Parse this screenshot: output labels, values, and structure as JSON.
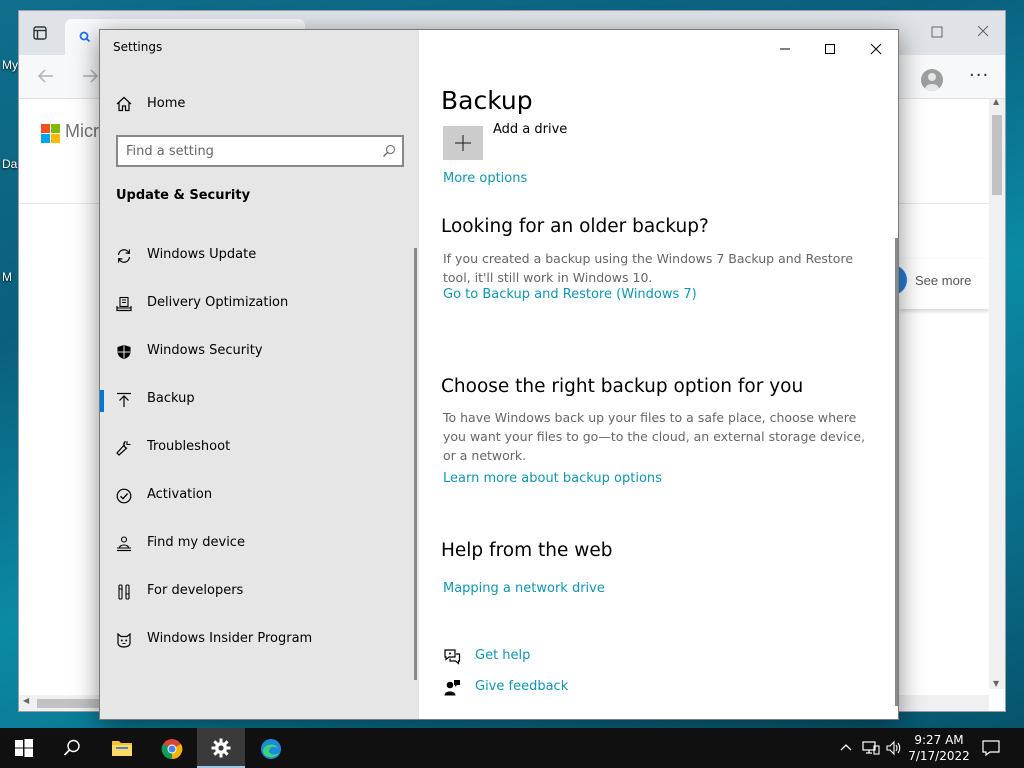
{
  "desktop": {
    "labels": [
      "My",
      "Da",
      "M"
    ]
  },
  "browser": {
    "brand_text": "Micro",
    "see_more": "See more",
    "more_glyph": "···"
  },
  "settings": {
    "window_title": "Settings",
    "nav": {
      "home_label": "Home",
      "search_placeholder": "Find a setting",
      "section_title": "Update & Security",
      "items": [
        {
          "label": "Windows Update",
          "icon": "sync-icon"
        },
        {
          "label": "Delivery Optimization",
          "icon": "delivery-icon"
        },
        {
          "label": "Windows Security",
          "icon": "shield-icon"
        },
        {
          "label": "Backup",
          "icon": "backup-arrow-icon",
          "selected": true
        },
        {
          "label": "Troubleshoot",
          "icon": "wrench-icon"
        },
        {
          "label": "Activation",
          "icon": "check-circle-icon"
        },
        {
          "label": "Find my device",
          "icon": "person-location-icon"
        },
        {
          "label": "For developers",
          "icon": "tools-icon"
        },
        {
          "label": "Windows Insider Program",
          "icon": "insider-cat-icon"
        }
      ]
    },
    "content": {
      "title": "Backup",
      "add_drive_label": "Add a drive",
      "more_options": "More options",
      "older_backup": {
        "heading": "Looking for an older backup?",
        "text": "If you created a backup using the Windows 7 Backup and Restore tool, it'll still work in Windows 10.",
        "link": "Go to Backup and Restore (Windows 7)"
      },
      "right_option": {
        "heading": "Choose the right backup option for you",
        "text": "To have Windows back up your files to a safe place, choose where you want your files to go—to the cloud, an external storage device, or a network.",
        "link": "Learn more about backup options"
      },
      "help_web": {
        "heading": "Help from the web",
        "link": "Mapping a network drive"
      },
      "get_help": "Get help",
      "give_feedback": "Give feedback"
    }
  },
  "taskbar": {
    "time": "9:27 AM",
    "date": "7/17/2022"
  },
  "colors": {
    "accent": "#0078d7",
    "link": "#0f96b0",
    "nav_bg": "#e6e6e6",
    "taskbar_bg": "#101010"
  }
}
